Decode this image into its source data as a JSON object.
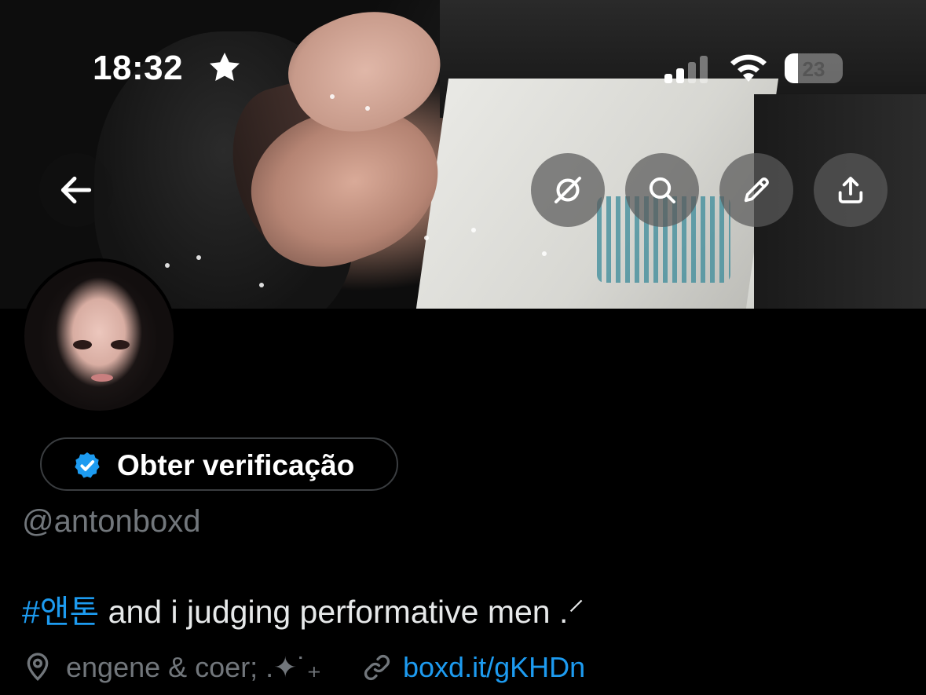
{
  "status_bar": {
    "time": "18:32",
    "battery_level": "23",
    "battery_fraction": 0.23
  },
  "banner": {
    "back_icon": "arrow-left-icon",
    "actions": [
      {
        "name": "grok-icon"
      },
      {
        "name": "search-icon"
      },
      {
        "name": "edit-pencil-icon"
      },
      {
        "name": "share-icon"
      }
    ]
  },
  "profile": {
    "verify_label": "Obter verificação",
    "verify_icon": "verified-badge-icon",
    "handle": "@antonboxd",
    "bio_hashtag": "#앤톤",
    "bio_text": " and i judging performative men .⸍",
    "location": "engene & coer; .✦˙₊",
    "link": "boxd.it/gKHDn"
  },
  "colors": {
    "accent": "#1d9bf0",
    "muted_text": "#71767b",
    "background": "#000000"
  }
}
